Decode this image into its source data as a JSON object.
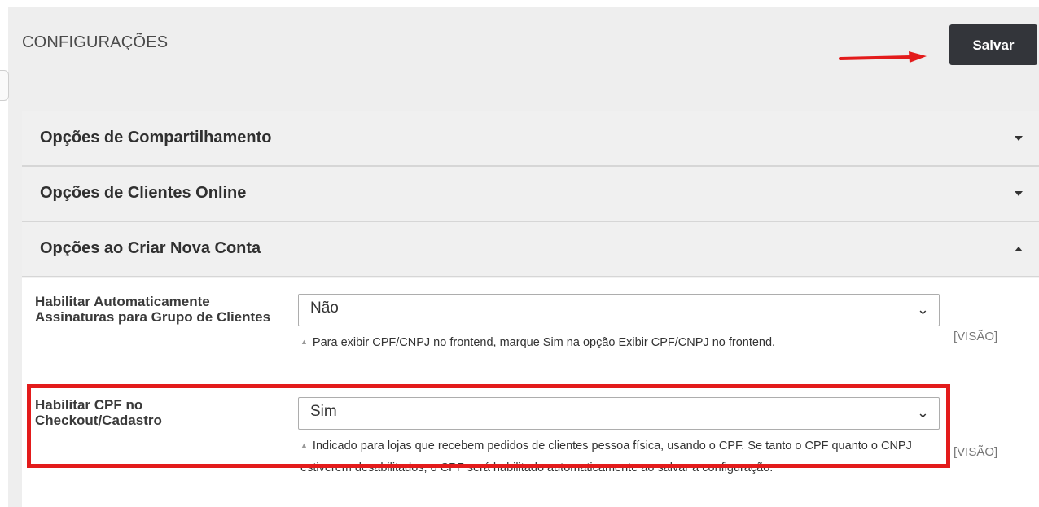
{
  "header": {
    "title": "CONFIGURAÇÕES",
    "save_label": "Salvar"
  },
  "sections": [
    {
      "label": "Opções de Compartilhamento",
      "state": "collapsed"
    },
    {
      "label": "Opções de Clientes Online",
      "state": "collapsed"
    },
    {
      "label": "Opções ao Criar Nova Conta",
      "state": "expanded"
    }
  ],
  "fields": [
    {
      "label": "Habilitar Automaticamente Assinaturas para Grupo de Clientes",
      "value": "Não",
      "note": "Para exibir CPF/CNPJ no frontend, marque Sim na opção Exibir CPF/CNPJ no frontend.",
      "scope": "[VISÃO]"
    },
    {
      "label": "Habilitar CPF no Checkout/Cadastro",
      "value": "Sim",
      "note": "Indicado para lojas que recebem pedidos de clientes pessoa física, usando o CPF. Se tanto o CPF quanto o CNPJ estiverem desabilitados, o CPF será habilitado automaticamente ao salvar a configuração.",
      "scope": "[VISÃO]"
    }
  ],
  "colors": {
    "annotation": "#e31b1b",
    "button_bg": "#33353a"
  },
  "icons": {
    "collapsed": "chevron-down-icon",
    "expanded": "chevron-up-icon",
    "select": "chevron-down-icon"
  }
}
